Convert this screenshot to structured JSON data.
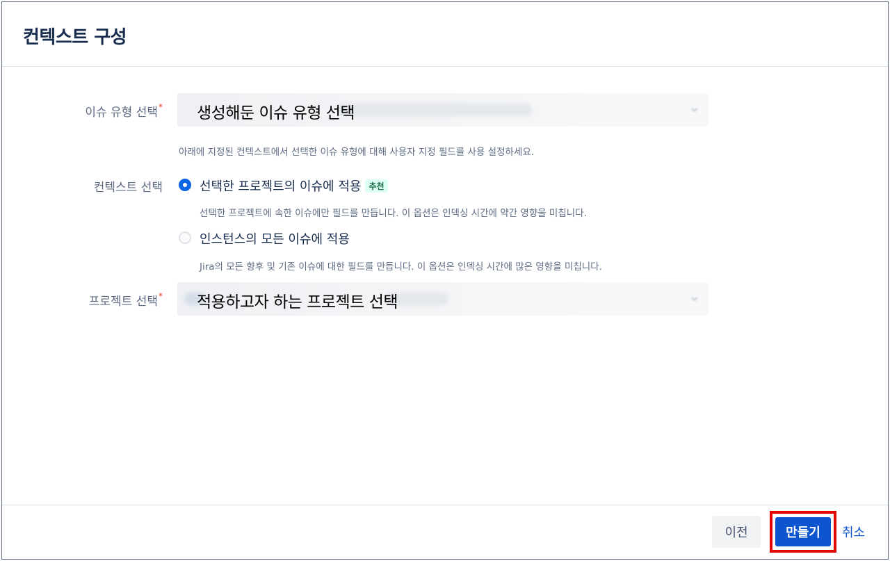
{
  "dialog": {
    "title": "컨텍스트 구성"
  },
  "issue_type": {
    "label": "이슈 유형 선택",
    "required_mark": "*",
    "value_annotation": "생성해둔 이슈 유형 선택",
    "helper": "아래에 지정된 컨텍스트에서 선택한 이슈 유형에 대해 사용자 지정 필드를 사용 설정하세요."
  },
  "context": {
    "label": "컨텍스트 선택",
    "options": [
      {
        "label": "선택한 프로젝트의 이슈에 적용",
        "badge": "추천",
        "selected": true,
        "description": "선택한 프로젝트에 속한 이슈에만 필드를 만듭니다. 이 옵션은 인덱싱 시간에 약간 영향을 미칩니다."
      },
      {
        "label": "인스턴스의 모든 이슈에 적용",
        "selected": false,
        "description": "Jira의 모든 향후 및 기존 이슈에 대한 필드를 만듭니다. 이 옵션은 인덱싱 시간에 많은 영향을 미칩니다."
      }
    ]
  },
  "project": {
    "label": "프로젝트 선택",
    "required_mark": "*",
    "value_annotation": "적용하고자 하는 프로젝트 선택"
  },
  "footer": {
    "back_label": "이전",
    "create_label": "만들기",
    "cancel_label": "취소"
  },
  "colors": {
    "primary": "#0c55cf",
    "highlight": "#e60000",
    "badge_bg": "#dcfff1",
    "badge_text": "#216e4e"
  },
  "icons": {
    "select_chevron": "chevron-down-icon",
    "radio_selected": "radio-selected-icon",
    "radio_unselected": "radio-unselected-icon"
  }
}
